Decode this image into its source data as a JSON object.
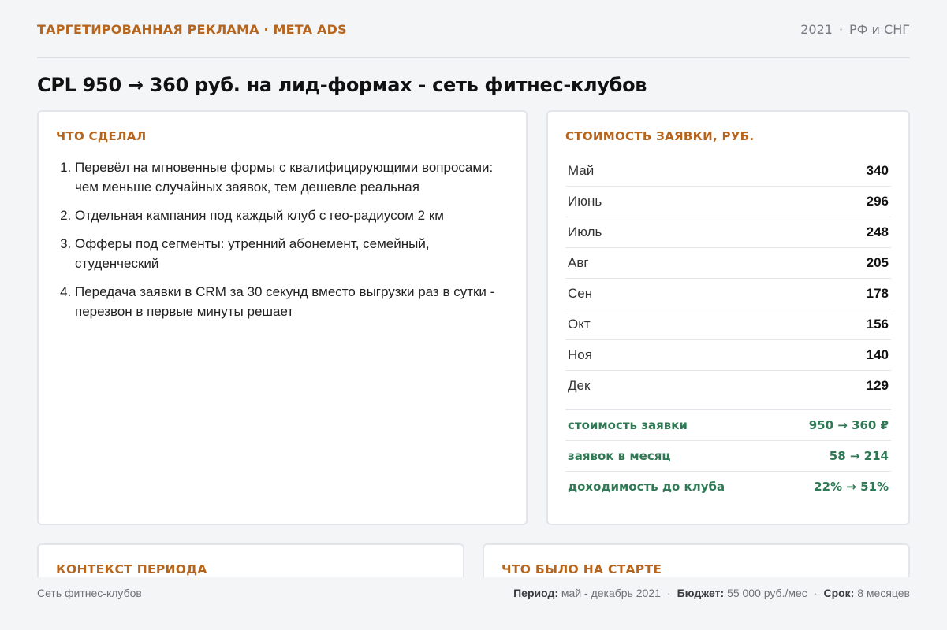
{
  "header": {
    "kicker": "ТАРГЕТИРОВАННАЯ РЕКЛАМА · META ADS",
    "year": "2021",
    "region": "РФ и СНГ",
    "title": "CPL 950 → 360 руб. на лид-формах - сеть фитнес-клубов"
  },
  "done": {
    "title": "ЧТО СДЕЛАЛ",
    "items": [
      "Перевёл на мгновенные формы с квалифицирующими вопросами: чем меньше случайных заявок, тем дешевле реальная",
      "Отдельная кампания под каждый клуб с гео-радиусом 2 км",
      "Офферы под сегменты: утренний абонемент, семейный, студенческий",
      "Передача заявки в CRM за 30 секунд вместо выгрузки раз в сутки - перезвон в первые минуты решает"
    ]
  },
  "cost": {
    "title": "СТОИМОСТЬ ЗАЯВКИ, РУБ.",
    "months": [
      {
        "month": "Май",
        "value": "340"
      },
      {
        "month": "Июнь",
        "value": "296"
      },
      {
        "month": "Июль",
        "value": "248"
      },
      {
        "month": "Авг",
        "value": "205"
      },
      {
        "month": "Сен",
        "value": "178"
      },
      {
        "month": "Окт",
        "value": "156"
      },
      {
        "month": "Ноя",
        "value": "140"
      },
      {
        "month": "Дек",
        "value": "129"
      }
    ],
    "summary": [
      {
        "label": "стоимость заявки",
        "value": "950 → 360 ₽"
      },
      {
        "label": "заявок в месяц",
        "value": "58 → 214"
      },
      {
        "label": "доходимость до клуба",
        "value": "22% → 51%"
      }
    ],
    "accent_color": "#2f7a55"
  },
  "context": {
    "title": "КОНТЕКСТ ПЕРИОДА"
  },
  "start": {
    "title": "ЧТО БЫЛО НА СТАРТЕ"
  },
  "footer": {
    "client": "Сеть фитнес-клубов",
    "period_label": "Период:",
    "period_value": "май - декабрь 2021",
    "budget_label": "Бюджет:",
    "budget_value": "55 000 руб./мес",
    "term_label": "Срок:",
    "term_value": "8 месяцев"
  },
  "colors": {
    "accent": "#b5651d",
    "positive": "#2f7a55",
    "background": "#f4f5f7"
  }
}
